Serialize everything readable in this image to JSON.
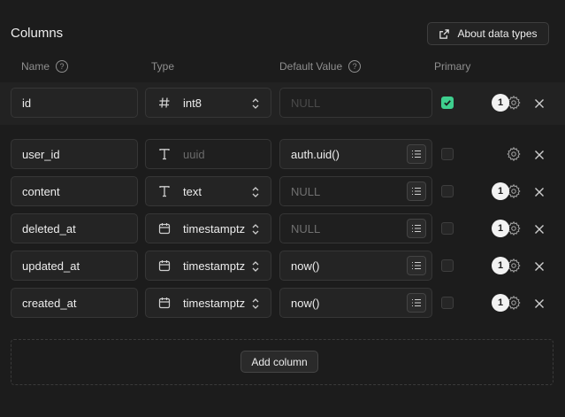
{
  "title": "Columns",
  "about_button": {
    "label": "About data types"
  },
  "headers": {
    "name": "Name",
    "type": "Type",
    "default": "Default Value",
    "primary": "Primary"
  },
  "rows": [
    {
      "name": "id",
      "type": "int8",
      "type_icon": "hash-icon",
      "default": "",
      "default_placeholder": "NULL",
      "primary": true,
      "badge": "1"
    },
    {
      "name": "user_id",
      "type": "uuid",
      "type_icon": "text-t-icon",
      "default": "auth.uid()",
      "primary": false,
      "badge": ""
    },
    {
      "name": "content",
      "type": "text",
      "type_icon": "text-t-icon",
      "default": "",
      "default_placeholder": "NULL",
      "primary": false,
      "badge": "1"
    },
    {
      "name": "deleted_at",
      "type": "timestamptz",
      "type_icon": "calendar-icon",
      "default": "",
      "default_placeholder": "NULL",
      "primary": false,
      "badge": "1"
    },
    {
      "name": "updated_at",
      "type": "timestamptz",
      "type_icon": "calendar-icon",
      "default": "now()",
      "primary": false,
      "badge": "1"
    },
    {
      "name": "created_at",
      "type": "timestamptz",
      "type_icon": "calendar-icon",
      "default": "now()",
      "primary": false,
      "badge": "1"
    }
  ],
  "add_column": {
    "label": "Add column"
  },
  "colors": {
    "accent": "#3ecf8e",
    "background": "#1c1c1c"
  }
}
